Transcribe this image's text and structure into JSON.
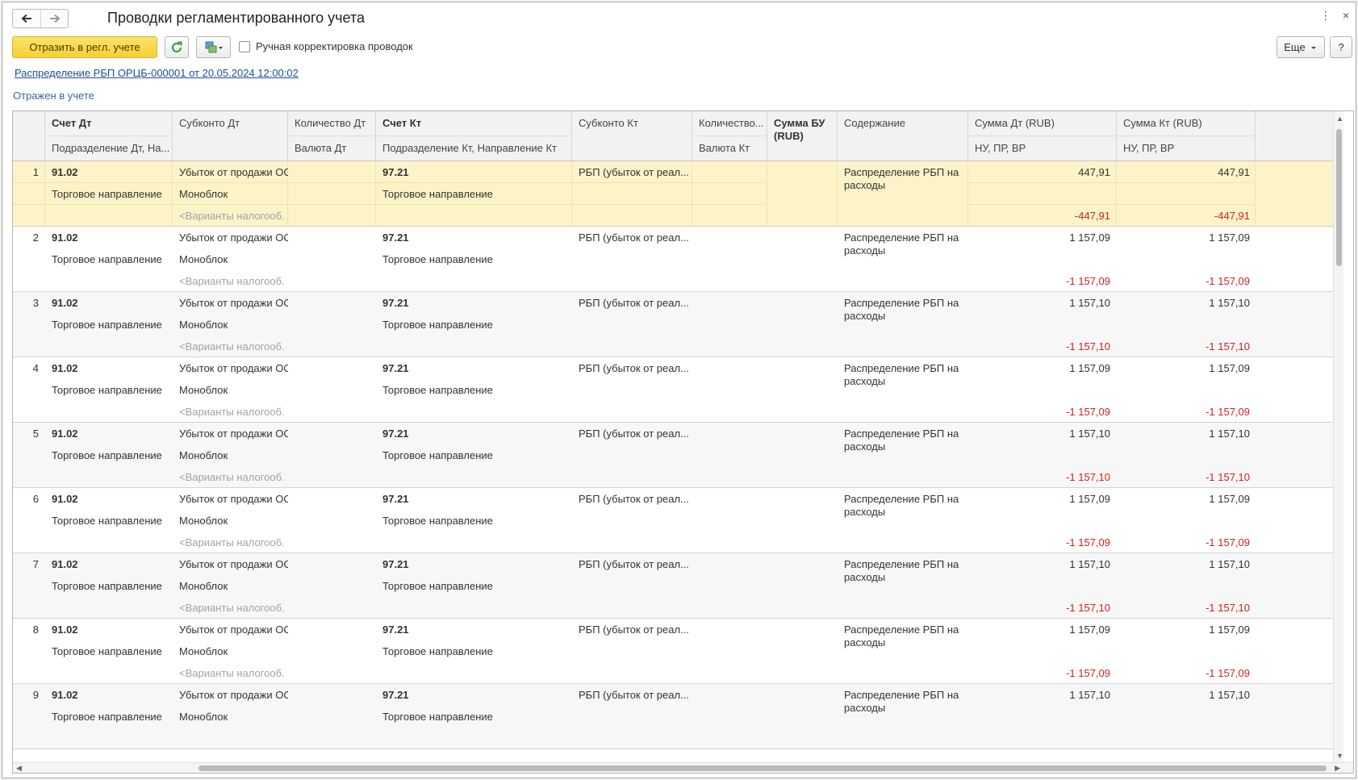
{
  "window": {
    "title": "Проводки регламентированного учета",
    "more_icon": "⋮",
    "close_icon": "×"
  },
  "toolbar": {
    "reflect_button": "Отразить в регл. учете",
    "manual_adjust_label": "Ручная корректировка проводок",
    "manual_adjust_checked": false,
    "more_button": "Еще",
    "help_button": "?"
  },
  "document_link": "Распределение РБП ОРЦБ-000001 от 20.05.2024 12:00:02",
  "status": "Отражен в учете",
  "colors": {
    "selected_row": "#fdf3c8",
    "primary_button": "#f5cf33",
    "negative": "#d42020",
    "link": "#1f4e9b"
  },
  "columns": {
    "account_dt": "Счет Дт",
    "dept_dt": "Подразделение Дт, На...",
    "subconto_dt": "Субконто Дт",
    "qty_dt": "Количество Дт",
    "currency_dt": "Валюта Дт",
    "account_kt": "Счет Кт",
    "dept_kt": "Подразделение Кт, Направление Кт",
    "subconto_kt": "Субконто Кт",
    "qty_kt": "Количество...",
    "currency_kt": "Валюта Кт",
    "sum_bu": "Сумма БУ (RUB)",
    "content": "Содержание",
    "sum_dt": "Сумма Дт (RUB)",
    "nu_dt": "НУ, ПР, ВР",
    "sum_kt": "Сумма Кт (RUB)",
    "nu_kt": "НУ, ПР, ВР"
  },
  "rows": [
    {
      "n": "1",
      "account_dt": "91.02",
      "dept_dt": "Торговое направление",
      "subconto_dt1": "Убыток от продажи ОС",
      "subconto_dt2": "Моноблок",
      "subconto_dt3": "<Варианты налогооб...",
      "account_kt": "97.21",
      "dept_kt": "Торговое направление",
      "subconto_kt": "РБП (убыток от реал...",
      "content": "Распределение РБП на расходы",
      "sum_dt": "447,91",
      "nu_dt": "-447,91",
      "sum_kt": "447,91",
      "nu_kt": "-447,91"
    },
    {
      "n": "2",
      "account_dt": "91.02",
      "dept_dt": "Торговое направление",
      "subconto_dt1": "Убыток от продажи ОС",
      "subconto_dt2": "Моноблок",
      "subconto_dt3": "<Варианты налогооб...",
      "account_kt": "97.21",
      "dept_kt": "Торговое направление",
      "subconto_kt": "РБП (убыток от реал...",
      "content": "Распределение РБП на расходы",
      "sum_dt": "1 157,09",
      "nu_dt": "-1 157,09",
      "sum_kt": "1 157,09",
      "nu_kt": "-1 157,09"
    },
    {
      "n": "3",
      "account_dt": "91.02",
      "dept_dt": "Торговое направление",
      "subconto_dt1": "Убыток от продажи ОС",
      "subconto_dt2": "Моноблок",
      "subconto_dt3": "<Варианты налогооб...",
      "account_kt": "97.21",
      "dept_kt": "Торговое направление",
      "subconto_kt": "РБП (убыток от реал...",
      "content": "Распределение РБП на расходы",
      "sum_dt": "1 157,10",
      "nu_dt": "-1 157,10",
      "sum_kt": "1 157,10",
      "nu_kt": "-1 157,10"
    },
    {
      "n": "4",
      "account_dt": "91.02",
      "dept_dt": "Торговое направление",
      "subconto_dt1": "Убыток от продажи ОС",
      "subconto_dt2": "Моноблок",
      "subconto_dt3": "<Варианты налогооб...",
      "account_kt": "97.21",
      "dept_kt": "Торговое направление",
      "subconto_kt": "РБП (убыток от реал...",
      "content": "Распределение РБП на расходы",
      "sum_dt": "1 157,09",
      "nu_dt": "-1 157,09",
      "sum_kt": "1 157,09",
      "nu_kt": "-1 157,09"
    },
    {
      "n": "5",
      "account_dt": "91.02",
      "dept_dt": "Торговое направление",
      "subconto_dt1": "Убыток от продажи ОС",
      "subconto_dt2": "Моноблок",
      "subconto_dt3": "<Варианты налогооб...",
      "account_kt": "97.21",
      "dept_kt": "Торговое направление",
      "subconto_kt": "РБП (убыток от реал...",
      "content": "Распределение РБП на расходы",
      "sum_dt": "1 157,10",
      "nu_dt": "-1 157,10",
      "sum_kt": "1 157,10",
      "nu_kt": "-1 157,10"
    },
    {
      "n": "6",
      "account_dt": "91.02",
      "dept_dt": "Торговое направление",
      "subconto_dt1": "Убыток от продажи ОС",
      "subconto_dt2": "Моноблок",
      "subconto_dt3": "<Варианты налогооб...",
      "account_kt": "97.21",
      "dept_kt": "Торговое направление",
      "subconto_kt": "РБП (убыток от реал...",
      "content": "Распределение РБП на расходы",
      "sum_dt": "1 157,09",
      "nu_dt": "-1 157,09",
      "sum_kt": "1 157,09",
      "nu_kt": "-1 157,09"
    },
    {
      "n": "7",
      "account_dt": "91.02",
      "dept_dt": "Торговое направление",
      "subconto_dt1": "Убыток от продажи ОС",
      "subconto_dt2": "Моноблок",
      "subconto_dt3": "<Варианты налогооб...",
      "account_kt": "97.21",
      "dept_kt": "Торговое направление",
      "subconto_kt": "РБП (убыток от реал...",
      "content": "Распределение РБП на расходы",
      "sum_dt": "1 157,10",
      "nu_dt": "-1 157,10",
      "sum_kt": "1 157,10",
      "nu_kt": "-1 157,10"
    },
    {
      "n": "8",
      "account_dt": "91.02",
      "dept_dt": "Торговое направление",
      "subconto_dt1": "Убыток от продажи ОС",
      "subconto_dt2": "Моноблок",
      "subconto_dt3": "<Варианты налогооб...",
      "account_kt": "97.21",
      "dept_kt": "Торговое направление",
      "subconto_kt": "РБП (убыток от реал...",
      "content": "Распределение РБП на расходы",
      "sum_dt": "1 157,09",
      "nu_dt": "-1 157,09",
      "sum_kt": "1 157,09",
      "nu_kt": "-1 157,09"
    },
    {
      "n": "9",
      "account_dt": "91.02",
      "dept_dt": "Торговое направление",
      "subconto_dt1": "Убыток от продажи ОС",
      "subconto_dt2": "Моноблок",
      "subconto_dt3": "",
      "account_kt": "97.21",
      "dept_kt": "Торговое направление",
      "subconto_kt": "РБП (убыток от реал...",
      "content": "Распределение РБП на расходы",
      "sum_dt": "1 157,10",
      "nu_dt": "",
      "sum_kt": "1 157,10",
      "nu_kt": ""
    }
  ]
}
